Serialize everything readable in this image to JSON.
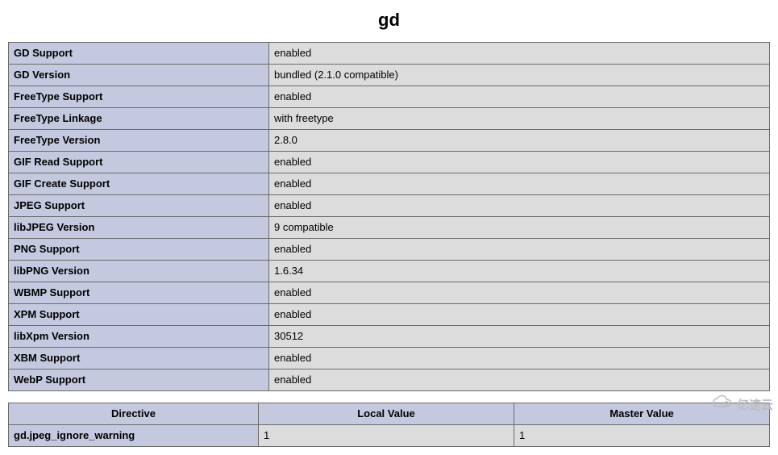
{
  "section_title": "gd",
  "info_rows": [
    {
      "key": "GD Support",
      "value": "enabled"
    },
    {
      "key": "GD Version",
      "value": "bundled (2.1.0 compatible)"
    },
    {
      "key": "FreeType Support",
      "value": "enabled"
    },
    {
      "key": "FreeType Linkage",
      "value": "with freetype"
    },
    {
      "key": "FreeType Version",
      "value": "2.8.0"
    },
    {
      "key": "GIF Read Support",
      "value": "enabled"
    },
    {
      "key": "GIF Create Support",
      "value": "enabled"
    },
    {
      "key": "JPEG Support",
      "value": "enabled"
    },
    {
      "key": "libJPEG Version",
      "value": "9 compatible"
    },
    {
      "key": "PNG Support",
      "value": "enabled"
    },
    {
      "key": "libPNG Version",
      "value": "1.6.34"
    },
    {
      "key": "WBMP Support",
      "value": "enabled"
    },
    {
      "key": "XPM Support",
      "value": "enabled"
    },
    {
      "key": "libXpm Version",
      "value": "30512"
    },
    {
      "key": "XBM Support",
      "value": "enabled"
    },
    {
      "key": "WebP Support",
      "value": "enabled"
    }
  ],
  "directive_table": {
    "headers": {
      "directive": "Directive",
      "local": "Local Value",
      "master": "Master Value"
    },
    "rows": [
      {
        "directive": "gd.jpeg_ignore_warning",
        "local": "1",
        "master": "1"
      }
    ]
  },
  "watermark_text": "亿速云"
}
